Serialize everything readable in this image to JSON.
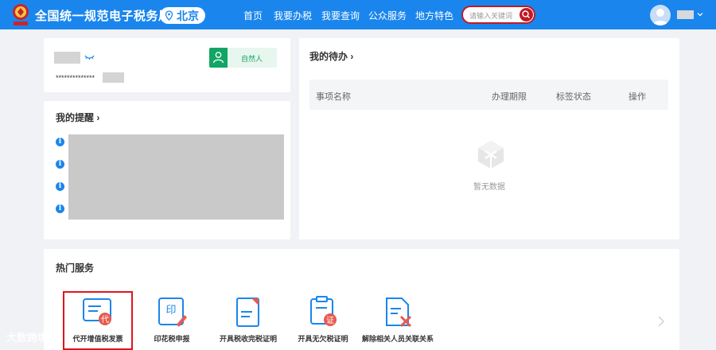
{
  "header": {
    "title": "全国统一规范电子税务局",
    "region": "北京",
    "nav": [
      "首页",
      "我要办税",
      "我要查询",
      "公众服务",
      "地方特色"
    ],
    "search_placeholder": "请输入关键词"
  },
  "profile": {
    "masked_id": "**************",
    "user_type": "自然人"
  },
  "reminders": {
    "title": "我的提醒"
  },
  "todo": {
    "title": "我的待办",
    "columns": [
      "事项名称",
      "办理期限",
      "标签状态",
      "操作"
    ],
    "empty_text": "暂无数据"
  },
  "hot_services": {
    "title": "热门服务",
    "items": [
      {
        "label": "代开增值税发票",
        "icon": "invoice-icon"
      },
      {
        "label": "印花税申报",
        "icon": "stamp-tax-icon"
      },
      {
        "label": "开具税收完税证明",
        "icon": "tax-certificate-icon"
      },
      {
        "label": "开具无欠税证明",
        "icon": "no-arrears-certificate-icon"
      },
      {
        "label": "解除相关人员关联关系",
        "icon": "unlink-person-icon"
      }
    ]
  },
  "watermark": "大数跨境",
  "colors": {
    "brand": "#1a86ed",
    "accent_red": "#e0141c",
    "green": "#12a565"
  }
}
